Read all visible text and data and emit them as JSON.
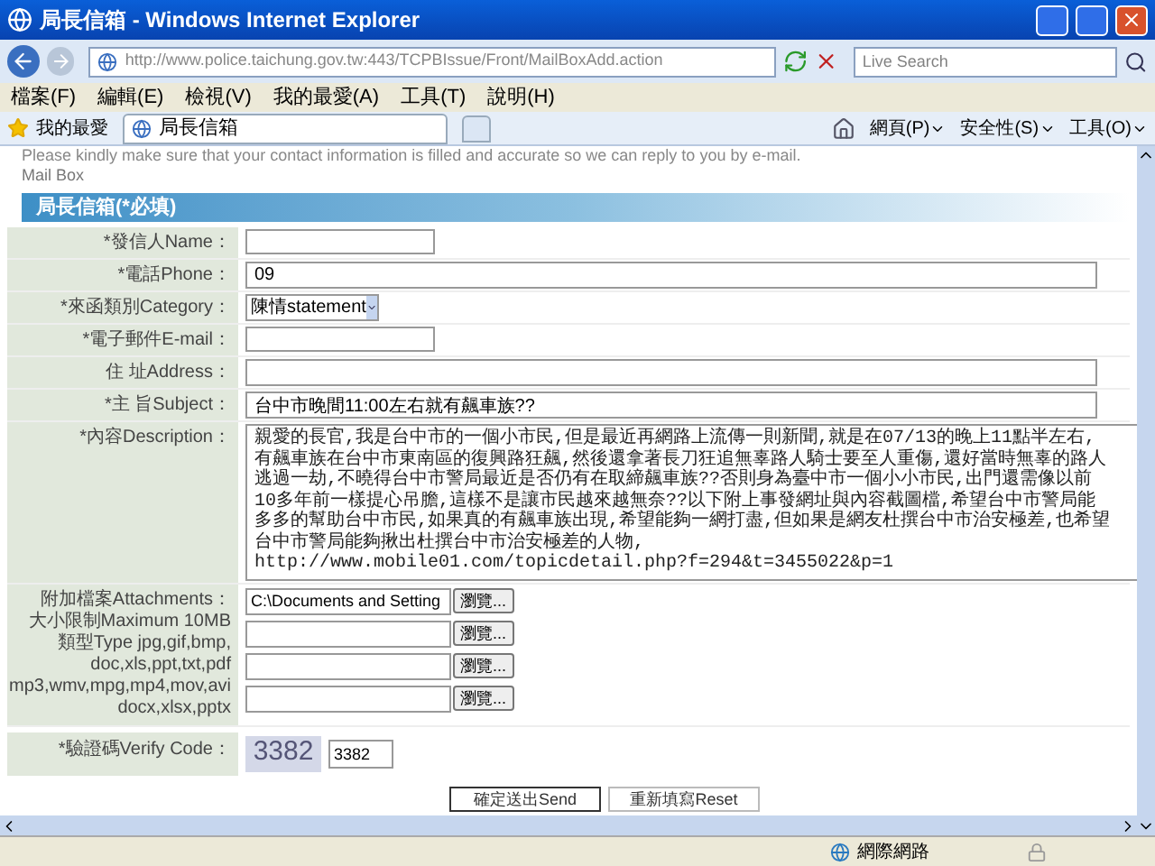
{
  "window": {
    "title": "局長信箱 - Windows Internet Explorer"
  },
  "address_bar": {
    "url": "http://www.police.taichung.gov.tw:443/TCPBIssue/Front/MailBoxAdd.action",
    "search_placeholder": "Live Search"
  },
  "menu": [
    "檔案(F)",
    "編輯(E)",
    "檢視(V)",
    "我的最愛(A)",
    "工具(T)",
    "說明(H)"
  ],
  "favorites_bar": {
    "favorites": "我的最愛",
    "tabs": [
      {
        "label": "局長信箱",
        "selected": true
      }
    ],
    "commands": [
      "網頁(P)",
      "安全性(S)",
      "工具(O)"
    ]
  },
  "page": {
    "notice": "Please kindly make sure that your contact information is filled and accurate so we can reply to you by e-mail.",
    "section": "Mail Box",
    "form_title": "局長信箱(*必填)",
    "fields": [
      {
        "kind": "short",
        "label": "*發信人Name："
      },
      {
        "kind": "long",
        "label": "*電話Phone：",
        "value": "09"
      },
      {
        "kind": "select",
        "label": "*來函類別Category：",
        "value": "陳情statement"
      },
      {
        "kind": "short",
        "label": "*電子郵件E-mail："
      },
      {
        "kind": "long",
        "label": "住 址Address："
      },
      {
        "kind": "long",
        "label": "*主 旨Subject：",
        "value": "台中市晚間11:00左右就有飆車族??"
      },
      {
        "kind": "textarea",
        "label": "*內容Description：",
        "lines": [
          "親愛的長官,我是台中市的一個小市民,但是最近再網路上流傳一則新聞,就是在07/13的晚上11點半左右,",
          "有飆車族在台中市東南區的復興路狂飆,然後還拿著長刀狂追無辜路人騎士要至人重傷,還好當時無辜的路人",
          "逃過一劫,不曉得台中市警局最近是否仍有在取締飆車族??否則身為臺中市一個小小市民,出門還需像以前",
          "10多年前一樣提心吊膽,這樣不是讓市民越來越無奈??以下附上事發網址與內容截圖檔,希望台中市警局能",
          "多多的幫助台中市民,如果真的有飆車族出現,希望能夠一網打盡,但如果是網友杜撰台中市治安極差,也希望",
          "台中市警局能夠揪出杜撰台中市治安極差的人物,",
          "http://www.mobile01.com/topicdetail.php?f=294&t=3455022&p=1"
        ]
      }
    ],
    "attachments": {
      "label_lines": [
        "附加檔案Attachments：",
        "大小限制Maximum 10MB",
        "類型Type jpg,gif,bmp,",
        "doc,xls,ppt,txt,pdf",
        "mp3,wmv,mpg,mp4,mov,avi",
        "docx,xlsx,pptx"
      ],
      "files": [
        {
          "value": "C:\\Documents and Setting",
          "button": "瀏覽..."
        },
        {
          "button": "瀏覽..."
        },
        {
          "button": "瀏覽..."
        },
        {
          "button": "瀏覽..."
        }
      ]
    },
    "verify": {
      "label": "*驗證碼Verify Code：",
      "captcha": "3382",
      "value": "3382"
    },
    "buttons": [
      "確定送出Send",
      "重新填寫Reset"
    ]
  },
  "status_bar": {
    "zone": "網際網路"
  }
}
